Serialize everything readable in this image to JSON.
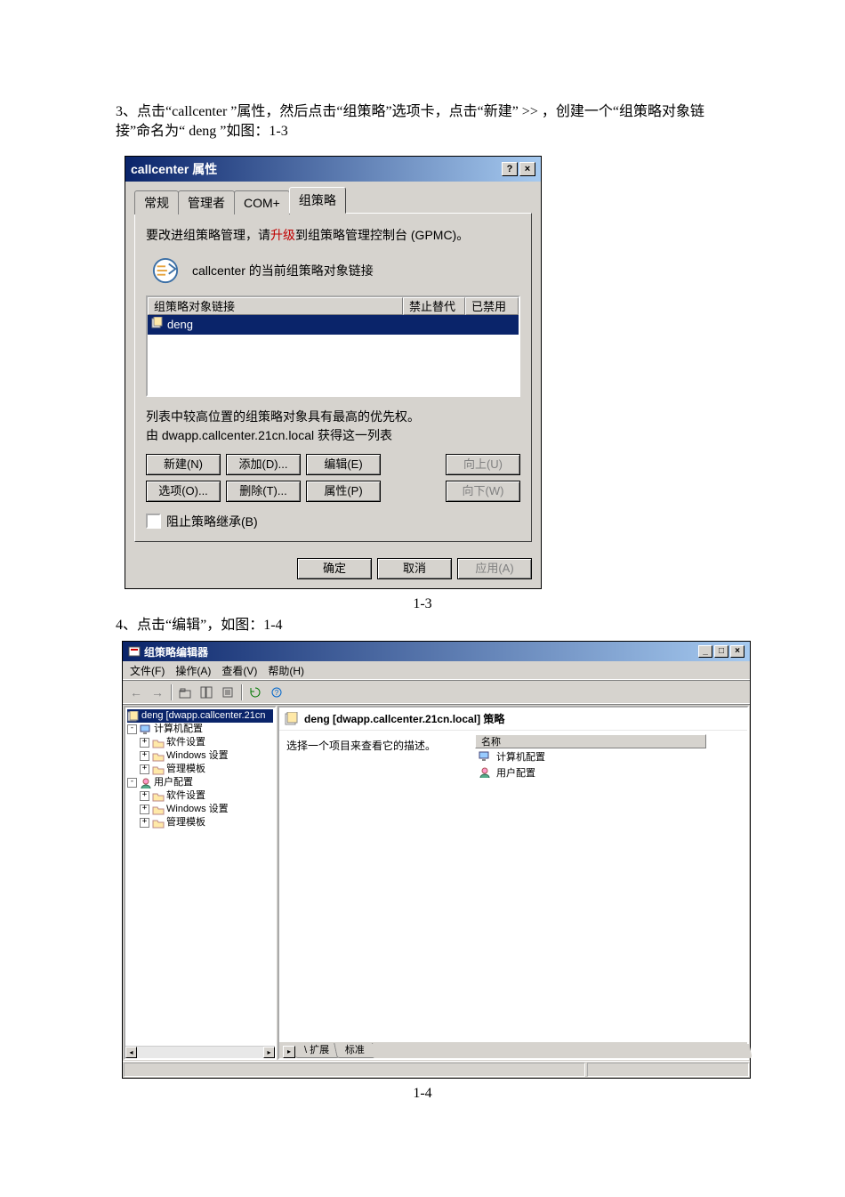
{
  "para1_a": "3、点击“",
  "para1_b": "callcenter ",
  "para1_c": "”属性，然后点击“组策略”选项卡，点击“新建”    >> ，创建一个“组策略对象链接”命名为“   deng ”如图：1-3",
  "dlg1": {
    "title": "callcenter 属性",
    "tabs": {
      "t1": "常规",
      "t2": "管理者",
      "t3": "COM+",
      "t4": "组策略"
    },
    "line1a": "要改进组策略管理，请",
    "line1b": "升级",
    "line1c": "到组策略管理控制台 (GPMC)。",
    "line2": "callcenter 的当前组策略对象链接",
    "hdr": {
      "c1": "组策略对象链接",
      "c2": "禁止替代",
      "c3": "已禁用"
    },
    "row1": "deng",
    "note1": "列表中较高位置的组策略对象具有最高的优先权。",
    "note2": "由 dwapp.callcenter.21cn.local 获得这一列表",
    "btns": {
      "new": "新建(N)",
      "add": "添加(D)...",
      "edit": "编辑(E)",
      "up": "向上(U)",
      "opt": "选项(O)...",
      "del": "删除(T)...",
      "prop": "属性(P)",
      "down": "向下(W)"
    },
    "block": "阻止策略继承(B)",
    "ok": "确定",
    "cancel": "取消",
    "apply": "应用(A)"
  },
  "figlabel1": "1-3",
  "para2": "4、点击“编辑”，如图：1-4",
  "win2": {
    "title": "组策略编辑器",
    "menus": {
      "file": "文件(F)",
      "action": "操作(A)",
      "view": "查看(V)",
      "help": "帮助(H)"
    },
    "tree": {
      "root": "deng [dwapp.callcenter.21cn",
      "n1": "计算机配置",
      "n1a": "软件设置",
      "n1b": "Windows 设置",
      "n1c": "管理模板",
      "n2": "用户配置",
      "n2a": "软件设置",
      "n2b": "Windows 设置",
      "n2c": "管理模板"
    },
    "rp": {
      "header": "deng [dwapp.callcenter.21cn.local] 策略",
      "desc": "选择一个项目来查看它的描述。",
      "col": "名称",
      "item1": "计算机配置",
      "item2": "用户配置",
      "tab1": "扩展",
      "tab2": "标准"
    }
  },
  "figlabel2": "1-4"
}
